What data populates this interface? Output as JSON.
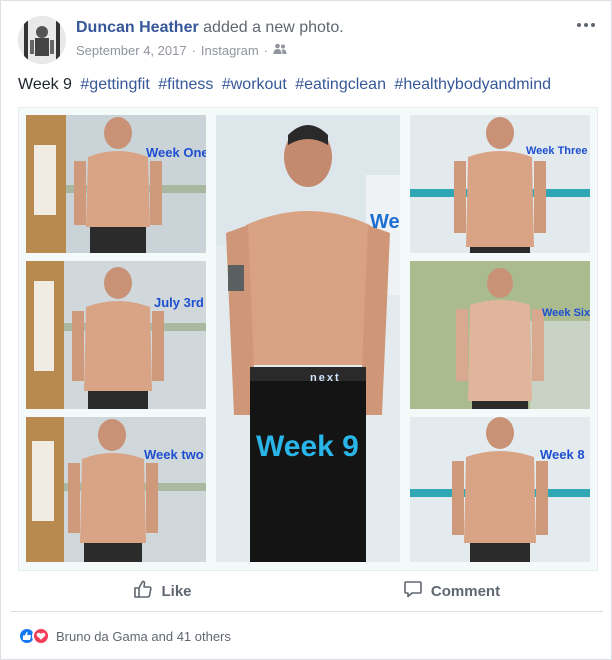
{
  "post": {
    "author": "Duncan Heather",
    "action_text": " added a new photo.",
    "date": "September 4, 2017",
    "source": "Instagram",
    "audience_icon": "friends-icon",
    "text_lead": "Week 9",
    "hashtags": [
      "#gettingfit",
      "#fitness",
      "#workout",
      "#eatingclean",
      "#healthybodyandmind"
    ]
  },
  "photo": {
    "labels": {
      "week_one": "Week One",
      "july_3rd": "July 3rd",
      "week_two": "Week two",
      "week_nine_big": "Week 9",
      "week_nine_partial": "We",
      "week_three": "Week Three",
      "week_six": "Week Six",
      "week_eight": "Week 8",
      "waistband": "next"
    }
  },
  "actions": {
    "like_label": "Like",
    "comment_label": "Comment"
  },
  "reactions": {
    "summary": "Bruno da Gama and 41 others",
    "types": [
      "like",
      "love"
    ]
  },
  "colors": {
    "link": "#365899",
    "like_blue": "#1877f2",
    "love_red": "#f33e58",
    "label_blue": "#1e4fd0"
  }
}
